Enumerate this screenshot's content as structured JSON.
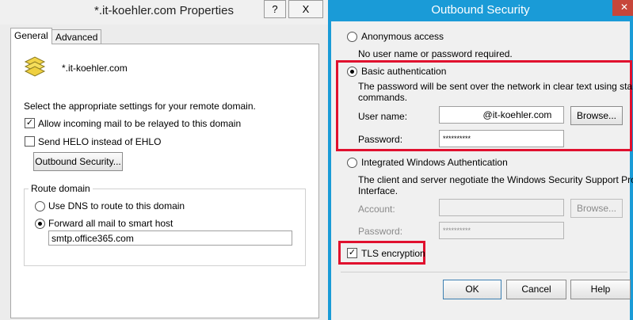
{
  "left_window": {
    "title": "*.it-koehler.com Properties",
    "help_glyph": "?",
    "close_glyph": "X",
    "tabs": [
      {
        "label": "General",
        "active": true
      },
      {
        "label": "Advanced",
        "active": false
      }
    ],
    "domain_name": "*.it-koehler.com",
    "domain_icon": "remote-domain-icon",
    "instructions": "Select the appropriate settings for your remote domain.",
    "allow_relay": {
      "label": "Allow incoming mail to be relayed to this domain",
      "checked": true
    },
    "send_helo": {
      "label": "Send HELO instead of EHLO",
      "checked": false
    },
    "outbound_security_button": "Outbound Security...",
    "route_domain": {
      "legend": "Route domain",
      "use_dns": {
        "label": "Use DNS to route to this domain",
        "selected": false
      },
      "forward": {
        "label": "Forward all mail to smart host",
        "selected": true
      },
      "smart_host": "smtp.office365.com"
    }
  },
  "outbound_dialog": {
    "title": "Outbound Security",
    "close_glyph": "✕",
    "anonymous": {
      "label": "Anonymous access",
      "selected": false,
      "description": "No user name or password required."
    },
    "basic": {
      "label": "Basic authentication",
      "selected": true,
      "description_line1": "The password will be sent over the network in clear text using standard",
      "description_line2": "commands.",
      "username_label": "User name:",
      "username_value": "@it-koehler.com",
      "browse_label": "Browse...",
      "password_label": "Password:",
      "password_value": "**********"
    },
    "integrated": {
      "label": "Integrated Windows Authentication",
      "selected": false,
      "description_line1": "The client and server negotiate the Windows Security Support Provider",
      "description_line2": "Interface.",
      "account_label": "Account:",
      "account_value": "",
      "browse_label": "Browse...",
      "password_label": "Password:",
      "password_value": "**********"
    },
    "tls": {
      "label": "TLS encryption",
      "checked": true
    },
    "buttons": {
      "ok": "OK",
      "cancel": "Cancel",
      "help": "Help"
    },
    "accent_color": "#1a9bd7",
    "highlight_color": "#e0102e"
  }
}
